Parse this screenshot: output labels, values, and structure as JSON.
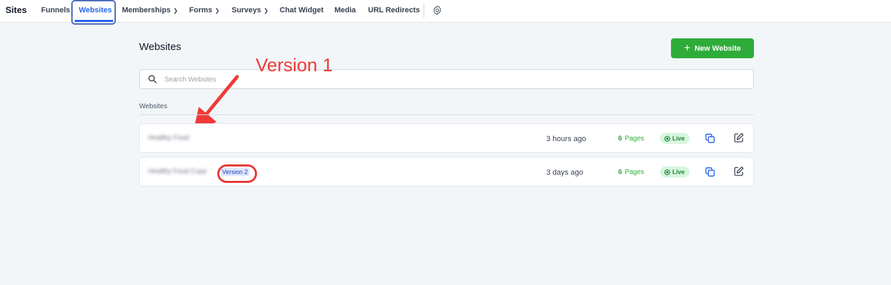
{
  "nav": {
    "brand": "Sites",
    "items": [
      {
        "label": "Funnels"
      },
      {
        "label": "Websites"
      },
      {
        "label": "Memberships"
      },
      {
        "label": "Forms"
      },
      {
        "label": "Surveys"
      },
      {
        "label": "Chat Widget"
      },
      {
        "label": "Media"
      },
      {
        "label": "URL Redirects"
      }
    ]
  },
  "main": {
    "title": "Websites",
    "new_button": "New Website",
    "search": {
      "placeholder": "Search Websites",
      "value": ""
    },
    "section_label": "Websites"
  },
  "annotation": {
    "text": "Version 1"
  },
  "websites": [
    {
      "name": "Healthy Food",
      "badge": "",
      "updated": "3 hours ago",
      "page_count": "6",
      "pages_label": "Pages",
      "status": "Live"
    },
    {
      "name": "Healthy Food Copy",
      "badge": "Version 2",
      "updated": "3 days ago",
      "page_count": "6",
      "pages_label": "Pages",
      "status": "Live"
    }
  ],
  "colors": {
    "accent": "#2563eb",
    "primary_button": "#2eac3a",
    "live_badge_bg": "#d7f5de",
    "annotation_red": "#f03a35"
  },
  "icons": [
    "gear-icon",
    "chevron-down-icon",
    "plus-icon",
    "search-icon",
    "live-dot-icon",
    "copy-icon",
    "edit-icon"
  ]
}
